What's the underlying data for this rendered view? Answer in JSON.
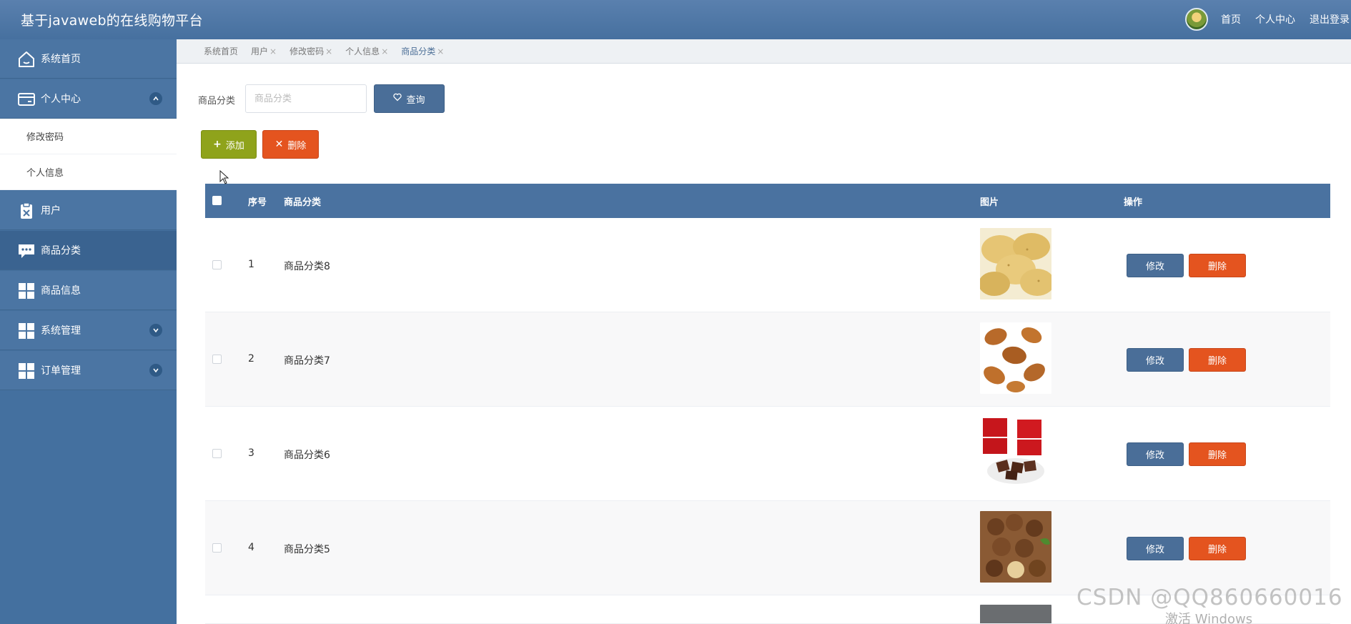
{
  "header": {
    "title": "基于javaweb的在线购物平台",
    "links": [
      "首页",
      "个人中心",
      "退出登录"
    ]
  },
  "sidebar": {
    "items": [
      {
        "label": "系统首页",
        "icon": "home-icon"
      },
      {
        "label": "个人中心",
        "icon": "card-icon",
        "expanded": true
      },
      {
        "label": "修改密码",
        "sub": true
      },
      {
        "label": "个人信息",
        "sub": true
      },
      {
        "label": "用户",
        "icon": "clipboard-icon"
      },
      {
        "label": "商品分类",
        "icon": "chat-icon",
        "active": true
      },
      {
        "label": "商品信息",
        "icon": "grid-icon"
      },
      {
        "label": "系统管理",
        "icon": "grid-icon",
        "collapsed": true
      },
      {
        "label": "订单管理",
        "icon": "grid-icon",
        "collapsed": true
      }
    ]
  },
  "tabs": [
    {
      "label": "系统首页",
      "closable": false
    },
    {
      "label": "用户",
      "closable": true
    },
    {
      "label": "修改密码",
      "closable": true
    },
    {
      "label": "个人信息",
      "closable": true
    },
    {
      "label": "商品分类",
      "closable": true,
      "current": true
    }
  ],
  "search": {
    "label": "商品分类",
    "placeholder": "商品分类",
    "query_button": "查询"
  },
  "actions": {
    "add_button": "添加",
    "delete_button": "删除"
  },
  "table": {
    "columns": [
      "序号",
      "商品分类",
      "图片",
      "操作"
    ],
    "rows": [
      {
        "index": "1",
        "category": "商品分类8",
        "image": "potatoes"
      },
      {
        "index": "2",
        "category": "商品分类7",
        "image": "fried-chicken"
      },
      {
        "index": "3",
        "category": "商品分类6",
        "image": "chocolate"
      },
      {
        "index": "4",
        "category": "商品分类5",
        "image": "nuts"
      }
    ],
    "edit_button": "修改",
    "delete_button": "删除"
  },
  "watermark": "CSDN @QQ860660016",
  "os_overlay": "激活 Windows",
  "colors": {
    "primary": "#4a6e98",
    "sidebar": "#44709f",
    "add": "#8fa31b",
    "danger": "#e4541f"
  }
}
